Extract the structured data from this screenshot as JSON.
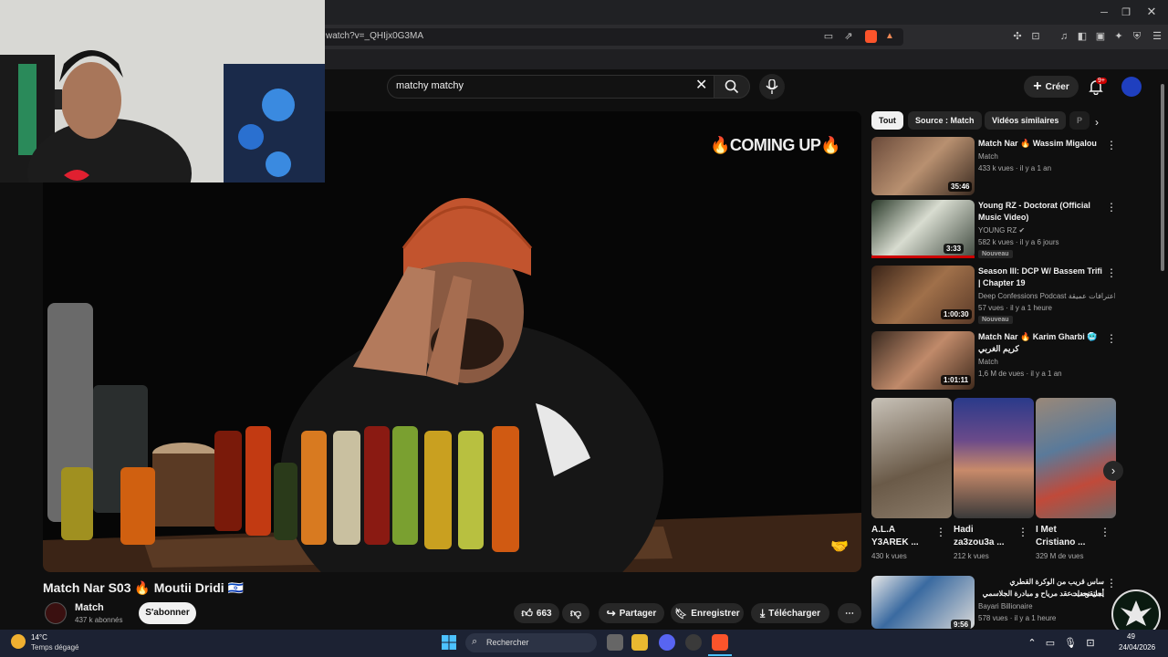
{
  "browser": {
    "url": "watch?v=_QHIjx0G3MA"
  },
  "header": {
    "search_value": "matchy matchy",
    "create_label": "Créer",
    "notif_count": "9+"
  },
  "video": {
    "overlay_text": "🔥COMING UP🔥",
    "title": "Match Nar S03 🔥 Moutii Dridi 🇮🇱",
    "channel_name": "Match",
    "channel_subs": "437 k abonnés",
    "subscribe_label": "S'abonner",
    "like_count": "663",
    "share_label": "Partager",
    "save_label": "Enregistrer",
    "download_label": "Télécharger"
  },
  "chips": [
    "Tout",
    "Source : Match",
    "Vidéos similaires",
    "P"
  ],
  "recommendations": [
    {
      "title": "Match Nar 🔥 Wassim Migalou",
      "title2": "",
      "channel": "Match",
      "meta": "433 k vues · il y a 1 an",
      "duration": "35:46",
      "badge": ""
    },
    {
      "title": "Young RZ - Doctorat (Official",
      "title2": "Music Video)",
      "channel": "YOUNG RZ ✔",
      "meta": "582 k vues · il y a 6 jours",
      "duration": "3:33",
      "badge": "Nouveau"
    },
    {
      "title": "Season III: DCP W/ Bassem Trifi",
      "title2": "| Chapter 19",
      "channel": "Deep Confessions Podcast بث اعترافات عميقة",
      "meta": "57 vues · il y a 1 heure",
      "duration": "1:00:30",
      "badge": "Nouveau"
    },
    {
      "title": "Match Nar 🔥 Karim Gharbi 🥶",
      "title2": "كريم الغربي",
      "channel": "Match",
      "meta": "1,6 M de vues · il y a 1 an",
      "duration": "1:01:11",
      "badge": ""
    }
  ],
  "shorts": [
    {
      "title": "A.L.A Y3AREK ...",
      "views": "430 k vues"
    },
    {
      "title": "Hadi za3zou3a ...",
      "views": "212 k vues"
    },
    {
      "title": "I Met Cristiano ...",
      "views": "329 M de vues"
    }
  ],
  "last_rec": {
    "title": "ساس قريب من الوكرة القطري يستقوضات",
    "title2": "أجل تجديد عقد مرياح و مبادرة الجلاسمي",
    "channel": "Bayari Billionaire",
    "meta": "578 vues · il y a 1 heure",
    "duration": "9:56"
  },
  "taskbar": {
    "weather_temp": "14°C",
    "weather_desc": "Temps dégagé",
    "search_placeholder": "Rechercher",
    "date": "24/04/2026",
    "time_fragment": "49"
  }
}
